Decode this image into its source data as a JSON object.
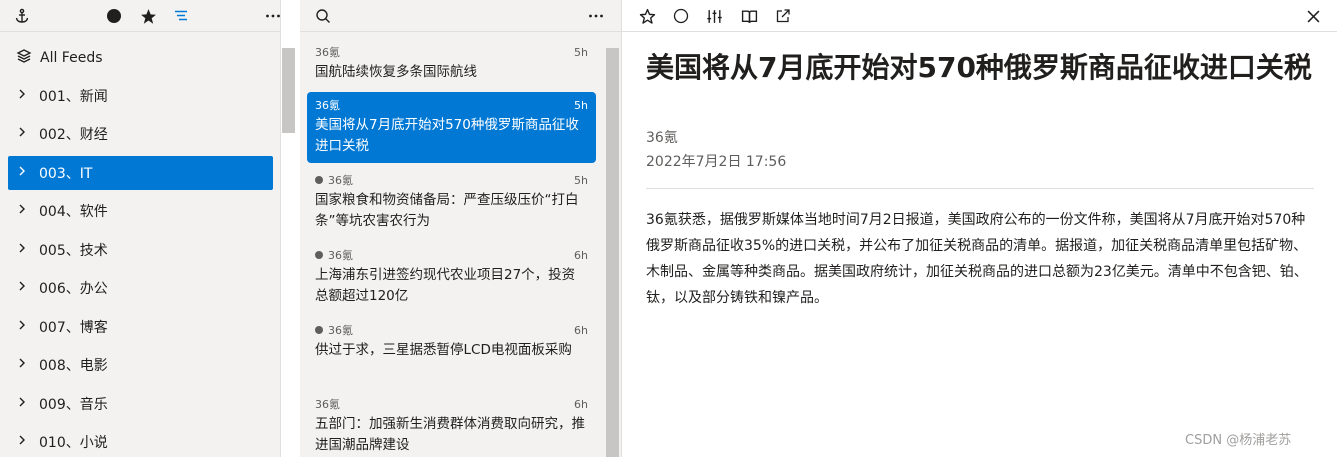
{
  "feeds": {
    "all_label": "All Feeds",
    "groups": [
      {
        "label": "001、新闻",
        "selected": false
      },
      {
        "label": "002、财经",
        "selected": false
      },
      {
        "label": "003、IT",
        "selected": true
      },
      {
        "label": "004、软件",
        "selected": false
      },
      {
        "label": "005、技术",
        "selected": false
      },
      {
        "label": "006、办公",
        "selected": false
      },
      {
        "label": "007、博客",
        "selected": false
      },
      {
        "label": "008、电影",
        "selected": false
      },
      {
        "label": "009、音乐",
        "selected": false
      },
      {
        "label": "010、小说",
        "selected": false
      }
    ]
  },
  "articles": [
    {
      "source": "36氪",
      "time": "5h",
      "title": "国航陆续恢复多条国际航线",
      "unread": false,
      "selected": false
    },
    {
      "source": "36氪",
      "time": "5h",
      "title": "美国将从7月底开始对570种俄罗斯商品征收进口关税",
      "unread": false,
      "selected": true
    },
    {
      "source": "36氪",
      "time": "5h",
      "title": "国家粮食和物资储备局：严查压级压价“打白条”等坑农害农行为",
      "unread": true,
      "selected": false
    },
    {
      "source": "36氪",
      "time": "6h",
      "title": "上海浦东引进签约现代农业项目27个，投资总额超过120亿",
      "unread": true,
      "selected": false
    },
    {
      "source": "36氪",
      "time": "6h",
      "title": "供过于求，三星据悉暂停LCD电视面板采购",
      "unread": true,
      "selected": false
    },
    {
      "source": "36氪",
      "time": "6h",
      "title": "五部门：加强新生消费群体消费取向研究，推进国潮品牌建设",
      "unread": false,
      "selected": false
    }
  ],
  "article": {
    "title": "美国将从7月底开始对570种俄罗斯商品征收进口关税",
    "source": "36氪",
    "date": "2022年7月2日 17:56",
    "body": "36氪获悉，据俄罗斯媒体当地时间7月2日报道，美国政府公布的一份文件称，美国将从7月底开始对570种俄罗斯商品征收35%的进口关税，并公布了加征关税商品的清单。据报道，加征关税商品清单里包括矿物、木制品、金属等种类商品。据美国政府统计，加征关税商品的进口总额为23亿美元。清单中不包含钯、铂、钛，以及部分铸铁和镍产品。"
  },
  "watermark": "CSDN @杨浦老苏",
  "colors": {
    "accent": "#0078d4",
    "pane": "#f3f2f1",
    "text": "#201f1e",
    "muted": "#605e5c"
  }
}
